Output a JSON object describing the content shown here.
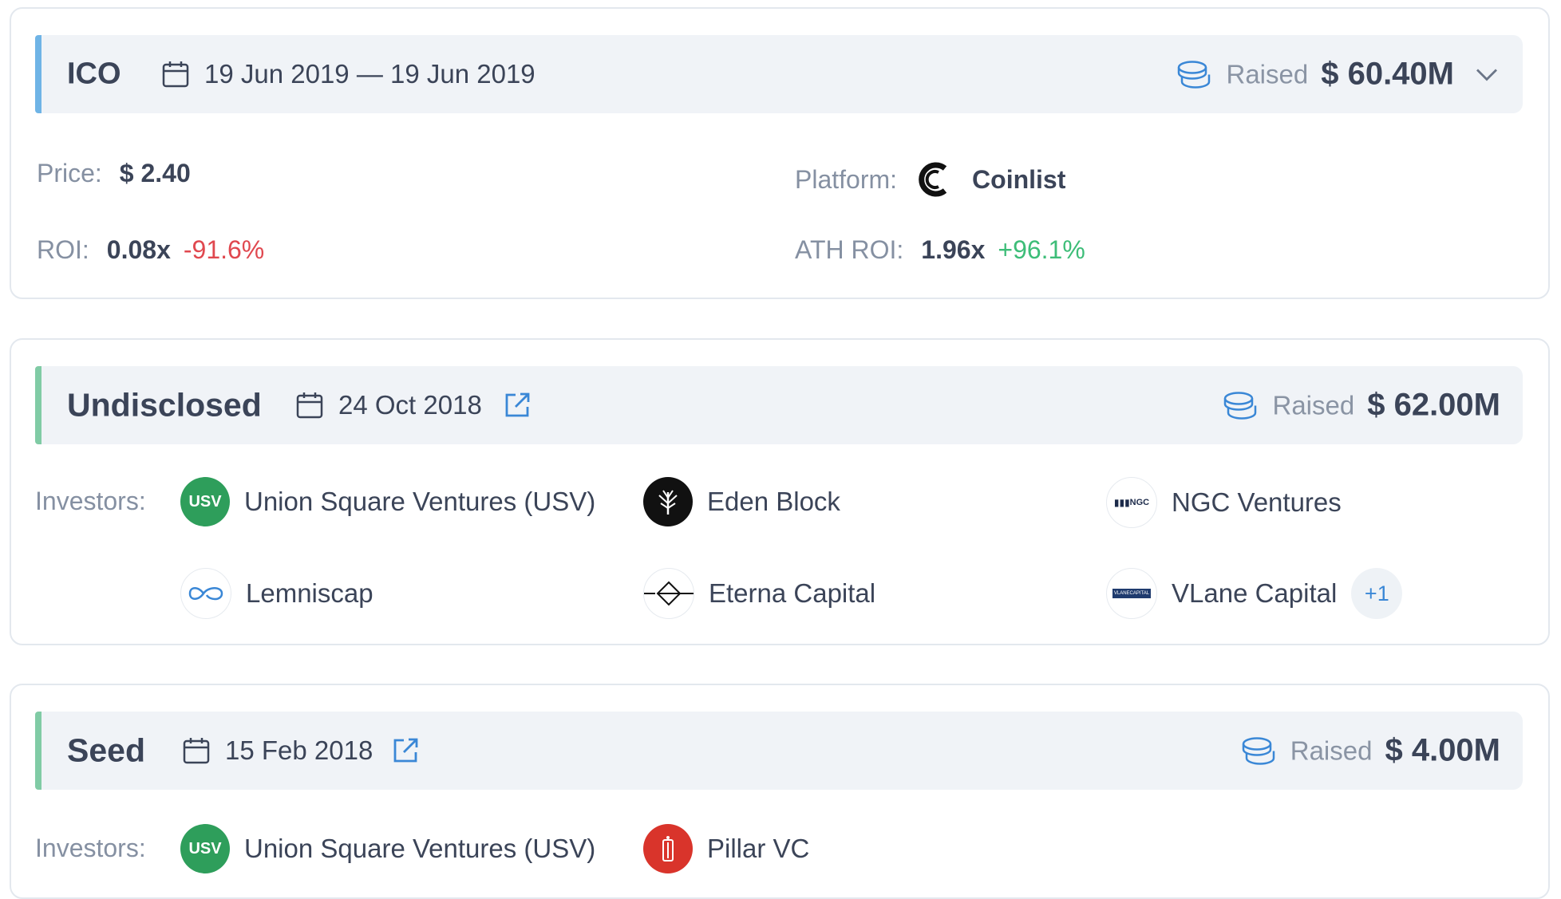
{
  "rounds": [
    {
      "name": "ICO",
      "date": "19 Jun 2019 — 19 Jun 2019",
      "raised_label": "Raised",
      "raised_value": "$ 60.40M",
      "price_label": "Price:",
      "price_value": "$ 2.40",
      "platform_label": "Platform:",
      "platform_value": "Coinlist",
      "roi_label": "ROI:",
      "roi_value": "0.08x",
      "roi_change": "-91.6%",
      "ath_roi_label": "ATH ROI:",
      "ath_roi_value": "1.96x",
      "ath_roi_change": "+96.1%"
    },
    {
      "name": "Undisclosed",
      "date": "24 Oct 2018",
      "raised_label": "Raised",
      "raised_value": "$ 62.00M",
      "investors_label": "Investors:",
      "investors": [
        {
          "name": "Union Square Ventures (USV)",
          "logo_text": "USV",
          "logo": "usv-logo"
        },
        {
          "name": "Eden Block",
          "logo": "eden-block-logo"
        },
        {
          "name": "NGC Ventures",
          "logo_text": "NGC",
          "logo": "ngc-logo"
        },
        {
          "name": "Lemniscap",
          "logo": "lemniscap-logo"
        },
        {
          "name": "Eterna Capital",
          "logo": "eterna-logo"
        },
        {
          "name": "VLane Capital",
          "logo_text": "VLANECAPITAL",
          "logo": "vlane-logo"
        }
      ],
      "more_count": "+1"
    },
    {
      "name": "Seed",
      "date": "15 Feb 2018",
      "raised_label": "Raised",
      "raised_value": "$ 4.00M",
      "investors_label": "Investors:",
      "investors": [
        {
          "name": "Union Square Ventures (USV)",
          "logo_text": "USV",
          "logo": "usv-logo"
        },
        {
          "name": "Pillar VC",
          "logo": "pillar-logo"
        }
      ]
    }
  ],
  "colors": {
    "ico_accent": "#6fb4e6",
    "round_accent": "#80cba5",
    "negative": "#e0484f",
    "positive": "#3dbd78",
    "link_blue": "#3a87d6"
  }
}
